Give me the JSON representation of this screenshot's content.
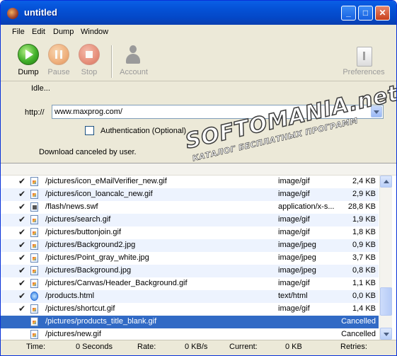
{
  "window": {
    "title": "untitled"
  },
  "menu": [
    "File",
    "Edit",
    "Dump",
    "Window"
  ],
  "toolbar": {
    "dump": "Dump",
    "pause": "Pause",
    "stop": "Stop",
    "account": "Account",
    "preferences": "Preferences"
  },
  "form": {
    "status": "Idle...",
    "url_label": "http://",
    "url_value": "www.maxprog.com/",
    "auth_label": "Authentication (Optional)",
    "message": "Download canceled by user."
  },
  "watermark": {
    "main": "SOFTOMANIA.net",
    "sub": "КАТАЛОГ БЕСПЛАТНЫХ ПРОГРАММ"
  },
  "files": [
    {
      "path": "/pictures/icon_eMailVerifier_new.gif",
      "type": "image/gif",
      "size": "2,4 KB",
      "checked": true,
      "icon": "image-file-icon"
    },
    {
      "path": "/pictures/icon_loancalc_new.gif",
      "type": "image/gif",
      "size": "2,9 KB",
      "checked": true,
      "icon": "image-file-icon"
    },
    {
      "path": "/flash/news.swf",
      "type": "application/x-s...",
      "size": "28,8 KB",
      "checked": true,
      "icon": "flash-file-icon"
    },
    {
      "path": "/pictures/search.gif",
      "type": "image/gif",
      "size": "1,9 KB",
      "checked": true,
      "icon": "image-file-icon"
    },
    {
      "path": "/pictures/buttonjoin.gif",
      "type": "image/gif",
      "size": "1,8 KB",
      "checked": true,
      "icon": "image-file-icon"
    },
    {
      "path": "/pictures/Background2.jpg",
      "type": "image/jpeg",
      "size": "0,9 KB",
      "checked": true,
      "icon": "image-file-icon"
    },
    {
      "path": "/pictures/Point_gray_white.jpg",
      "type": "image/jpeg",
      "size": "3,7 KB",
      "checked": true,
      "icon": "image-file-icon"
    },
    {
      "path": "/pictures/Background.jpg",
      "type": "image/jpeg",
      "size": "0,8 KB",
      "checked": true,
      "icon": "image-file-icon"
    },
    {
      "path": "/pictures/Canvas/Header_Background.gif",
      "type": "image/gif",
      "size": "1,1 KB",
      "checked": true,
      "icon": "image-file-icon"
    },
    {
      "path": "/products.html",
      "type": "text/html",
      "size": "0,0 KB",
      "checked": true,
      "icon": "html-file-icon"
    },
    {
      "path": "/pictures/shortcut.gif",
      "type": "image/gif",
      "size": "1,4 KB",
      "checked": true,
      "icon": "image-file-icon"
    },
    {
      "path": "/pictures/products_title_blank.gif",
      "type": "",
      "size": "Cancelled",
      "checked": false,
      "selected": true,
      "icon": "image-file-icon"
    },
    {
      "path": "/pictures/new.gif",
      "type": "",
      "size": "Cancelled",
      "checked": false,
      "icon": "image-file-icon"
    }
  ],
  "status_bar": {
    "time_label": "Time:",
    "time_value": "0 Seconds",
    "rate_label": "Rate:",
    "rate_value": "0 KB/s",
    "current_label": "Current:",
    "current_value": "0 KB",
    "retries_label": "Retries:"
  }
}
